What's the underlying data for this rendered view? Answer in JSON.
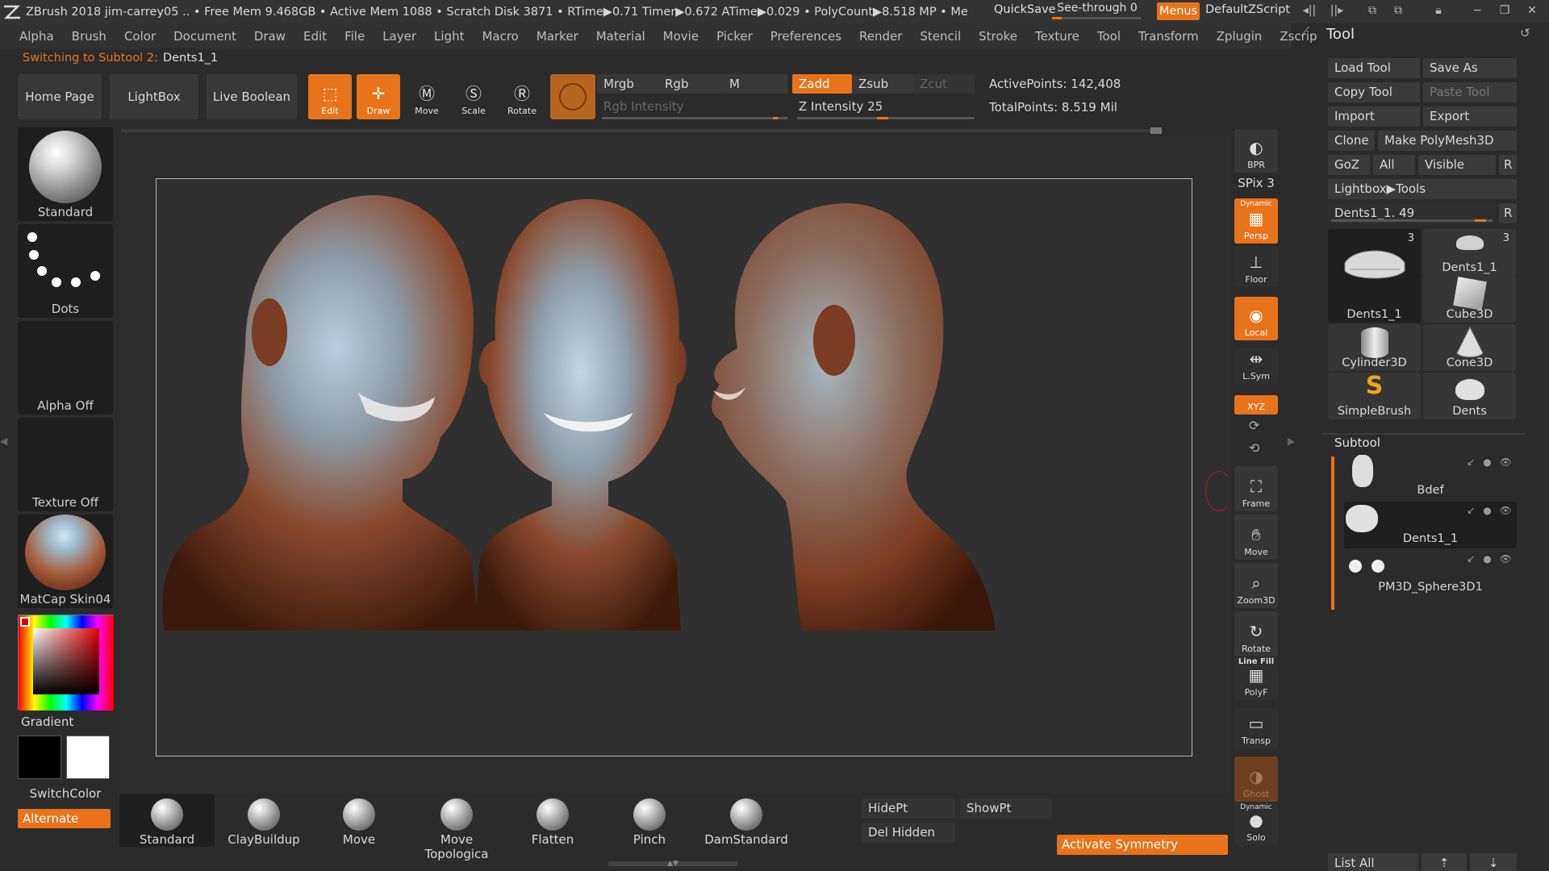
{
  "app": {
    "title_line": "ZBrush 2018   jim-carrey05   .. • Free Mem 9.468GB • Active Mem 1088 • Scratch Disk 3871 •  RTime▶0.71 Timer▶0.672 ATime▶0.029 • PolyCount▶8.518 MP  • Me",
    "quicksave": "QuickSave",
    "seethrough": "See-through  0",
    "menus": "Menus",
    "default_zscript": "DefaultZScript",
    "accent_color": "#e8731a"
  },
  "menubar": [
    "Alpha",
    "Brush",
    "Color",
    "Document",
    "Draw",
    "Edit",
    "File",
    "Layer",
    "Light",
    "Macro",
    "Marker",
    "Material",
    "Movie",
    "Picker",
    "Preferences",
    "Render",
    "Stencil",
    "Stroke",
    "Texture",
    "Tool",
    "Transform",
    "Zplugin",
    "Zscript"
  ],
  "status": {
    "prefix": "Switching to Subtool 2:",
    "value": "Dents1_1"
  },
  "top_shelf": {
    "home": "Home Page",
    "lightbox": "LightBox",
    "live_boolean": "Live Boolean",
    "edit": "Edit",
    "draw": "Draw",
    "move": "Move",
    "scale": "Scale",
    "rotate": "Rotate",
    "mrgb": "Mrgb",
    "rgb": "Rgb",
    "m": "M",
    "rgb_intensity": "Rgb Intensity",
    "zadd": "Zadd",
    "zsub": "Zsub",
    "zcut": "Zcut",
    "z_intensity": "Z Intensity 25",
    "z_intensity_value": 25,
    "active_points": "ActivePoints: 142,408",
    "total_points": "TotalPoints: 8.519 Mil"
  },
  "left_palette": {
    "brush": "Standard",
    "stroke": "Dots",
    "alpha": "Alpha Off",
    "texture": "Texture Off",
    "material": "MatCap Skin04",
    "gradient": "Gradient",
    "switch_color": "SwitchColor",
    "alternate": "Alternate"
  },
  "nav_strip": {
    "bpr": "BPR",
    "spix": "SPix 3",
    "dynamic": "Dynamic",
    "persp": "Persp",
    "floor": "Floor",
    "local": "Local",
    "lsym": "L.Sym",
    "xyz": "XYZ",
    "frame": "Frame",
    "move": "Move",
    "zoom3d": "Zoom3D",
    "rotate": "Rotate",
    "linefill": "Line Fill",
    "polyf": "PolyF",
    "transp": "Transp",
    "ghost": "Ghost",
    "dynamic2": "Dynamic",
    "solo": "Solo"
  },
  "tool_panel": {
    "title": "Tool",
    "load_tool": "Load Tool",
    "save_as": "Save As",
    "copy_tool": "Copy Tool",
    "paste_tool": "Paste Tool",
    "import": "Import",
    "export": "Export",
    "clone": "Clone",
    "make_polymesh": "Make PolyMesh3D",
    "goz": "GoZ",
    "all": "All",
    "visible": "Visible",
    "r": "R",
    "lightbox_tools": "Lightbox▶Tools",
    "current_tool": "Dents1_1. 49",
    "thumbs": [
      {
        "label": "Dents1_1",
        "count": "3"
      },
      {
        "label": "Dents1_1",
        "count": "3"
      },
      {
        "label": "Cube3D",
        "count": ""
      },
      {
        "label": "Cylinder3D",
        "count": ""
      },
      {
        "label": "Cone3D",
        "count": ""
      },
      {
        "label": "SimpleBrush",
        "count": ""
      },
      {
        "label": "Dents",
        "count": ""
      }
    ],
    "subtool_title": "Subtool",
    "subtools": [
      "Bdef",
      "Dents1_1",
      "PM3D_Sphere3D1"
    ],
    "list_all": "List All"
  },
  "bottom_shelf": {
    "brushes": [
      "Standard",
      "ClayBuildup",
      "Move",
      "Move Topologica",
      "Flatten",
      "Pinch",
      "DamStandard"
    ],
    "hidept": "HidePt",
    "showpt": "ShowPt",
    "del_hidden": "Del Hidden",
    "activate_symmetry": "Activate Symmetry"
  }
}
